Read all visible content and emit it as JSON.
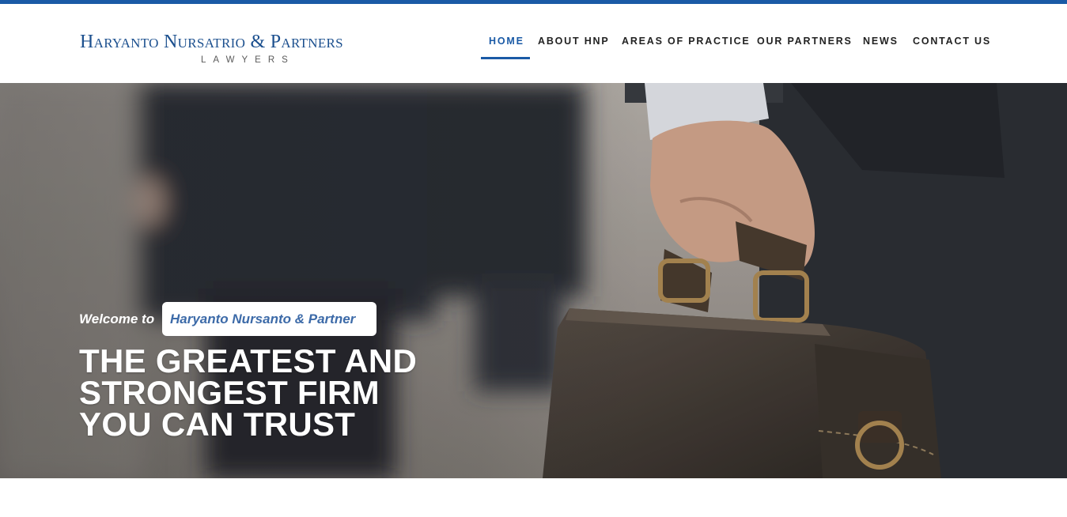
{
  "brand": {
    "name": "Haryanto Nursatrio & Partners",
    "subtitle": "LAWYERS",
    "accent_color": "#1a5aa6"
  },
  "nav": {
    "items": [
      {
        "label": "HOME",
        "active": true
      },
      {
        "label": "ABOUT HNP",
        "active": false
      },
      {
        "label": "AREAS OF PRACTICE",
        "active": false
      },
      {
        "label": "OUR PARTNERS",
        "active": false
      },
      {
        "label": "NEWS",
        "active": false
      },
      {
        "label": "CONTACT US",
        "active": false
      }
    ]
  },
  "hero": {
    "welcome_prefix": "Welcome to",
    "welcome_highlight": "Haryanto Nursanto & Partner",
    "headline_lines": [
      "THE GREATEST AND",
      "STRONGEST FIRM",
      "YOU CAN TRUST"
    ]
  }
}
